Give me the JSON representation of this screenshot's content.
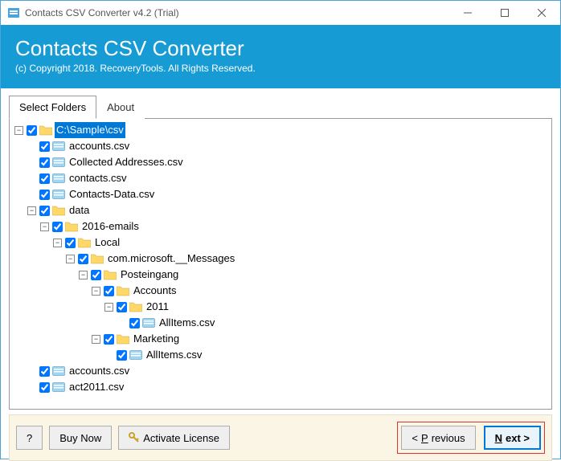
{
  "window": {
    "title": "Contacts CSV Converter v4.2 (Trial)"
  },
  "header": {
    "title": "Contacts CSV Converter",
    "copy": "(c) Copyright 2018. RecoveryTools. All Rights Reserved."
  },
  "tabs": {
    "folders": "Select Folders",
    "about": "About"
  },
  "tree": [
    {
      "d": 0,
      "exp": "-",
      "kind": "folder",
      "label": "C:\\Sample\\csv",
      "sel": true
    },
    {
      "d": 1,
      "exp": "",
      "kind": "csv",
      "label": "accounts.csv"
    },
    {
      "d": 1,
      "exp": "",
      "kind": "csv",
      "label": "Collected Addresses.csv"
    },
    {
      "d": 1,
      "exp": "",
      "kind": "csv",
      "label": "contacts.csv"
    },
    {
      "d": 1,
      "exp": "",
      "kind": "csv",
      "label": "Contacts-Data.csv"
    },
    {
      "d": 1,
      "exp": "-",
      "kind": "folder",
      "label": "data"
    },
    {
      "d": 2,
      "exp": "-",
      "kind": "folder",
      "label": "2016-emails"
    },
    {
      "d": 3,
      "exp": "-",
      "kind": "folder",
      "label": "Local"
    },
    {
      "d": 4,
      "exp": "-",
      "kind": "folder",
      "label": "com.microsoft.__Messages"
    },
    {
      "d": 5,
      "exp": "-",
      "kind": "folder",
      "label": "Posteingang"
    },
    {
      "d": 6,
      "exp": "-",
      "kind": "folder",
      "label": "Accounts"
    },
    {
      "d": 7,
      "exp": "-",
      "kind": "folder",
      "label": "2011"
    },
    {
      "d": 8,
      "exp": "",
      "kind": "csv",
      "label": "AllItems.csv"
    },
    {
      "d": 6,
      "exp": "-",
      "kind": "folder",
      "label": "Marketing"
    },
    {
      "d": 7,
      "exp": "",
      "kind": "csv",
      "label": "AllItems.csv"
    },
    {
      "d": 1,
      "exp": "",
      "kind": "csv",
      "label": "accounts.csv"
    },
    {
      "d": 1,
      "exp": "",
      "kind": "csv",
      "label": "act2011.csv"
    }
  ],
  "footer": {
    "help": "?",
    "buy": "Buy Now",
    "activate": "Activate License",
    "prev_pre": "<  ",
    "prev_u": "P",
    "prev_rest": "revious",
    "next_u": "N",
    "next_rest": "ext >"
  }
}
